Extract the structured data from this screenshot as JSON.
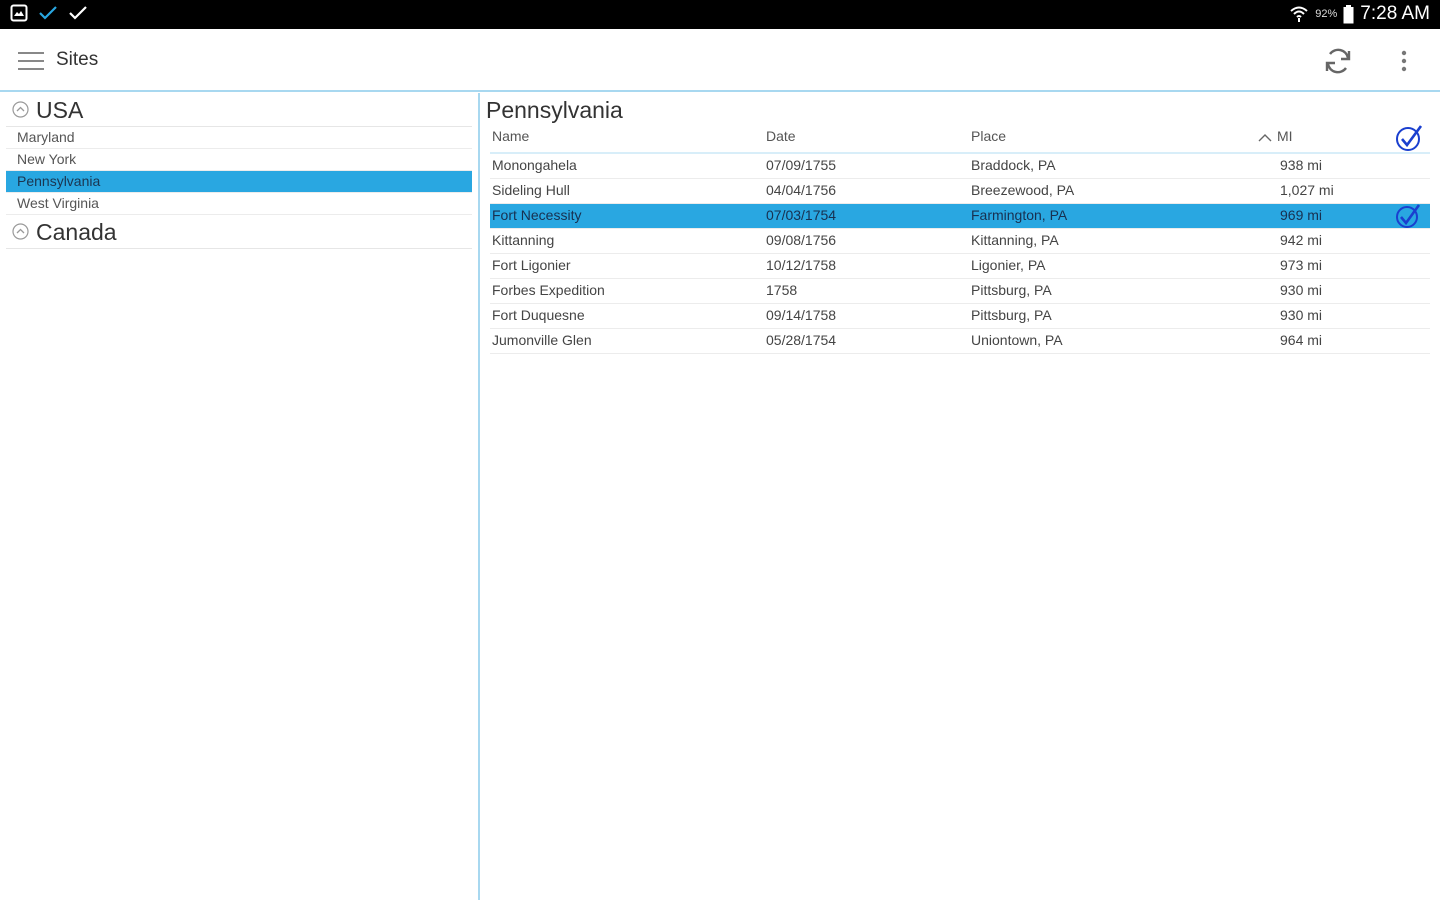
{
  "status_bar": {
    "battery_pct": "92%",
    "time": "7:28 AM"
  },
  "toolbar": {
    "title": "Sites"
  },
  "left_pane": {
    "groups": [
      {
        "label": "USA",
        "expanded": true,
        "items": [
          "Maryland",
          "New York",
          "Pennsylvania",
          "West Virginia"
        ]
      },
      {
        "label": "Canada",
        "expanded": true,
        "items": []
      }
    ],
    "selected_item": "Pennsylvania"
  },
  "right_pane": {
    "title": "Pennsylvania",
    "columns": {
      "name": "Name",
      "date": "Date",
      "place": "Place",
      "mi": "MI"
    },
    "sort": {
      "column": "MI",
      "direction": "ascending"
    },
    "rows": [
      {
        "name": "Monongahela",
        "date": "07/09/1755",
        "place": "Braddock, PA",
        "mi": "938 mi",
        "selected": false
      },
      {
        "name": "Sideling Hull",
        "date": "04/04/1756",
        "place": "Breezewood, PA",
        "mi": "1,027 mi",
        "selected": false
      },
      {
        "name": "Fort Necessity",
        "date": "07/03/1754",
        "place": "Farmington, PA",
        "mi": "969 mi",
        "selected": true
      },
      {
        "name": "Kittanning",
        "date": "09/08/1756",
        "place": "Kittanning, PA",
        "mi": "942 mi",
        "selected": false
      },
      {
        "name": "Fort Ligonier",
        "date": "10/12/1758",
        "place": "Ligonier, PA",
        "mi": "973 mi",
        "selected": false
      },
      {
        "name": "Forbes Expedition",
        "date": "1758",
        "place": "Pittsburg, PA",
        "mi": "930 mi",
        "selected": false
      },
      {
        "name": "Fort Duquesne",
        "date": "09/14/1758",
        "place": "Pittsburg, PA",
        "mi": "930 mi",
        "selected": false
      },
      {
        "name": "Jumonville Glen",
        "date": "05/28/1754",
        "place": "Uniontown, PA",
        "mi": "964 mi",
        "selected": false
      }
    ]
  },
  "colors": {
    "accent": "#29a7e1",
    "divider": "#a8d8f0",
    "check_blue": "#1a3fcf"
  },
  "icons": {
    "status_left": [
      "gallery-icon",
      "check-icon",
      "check-icon"
    ],
    "status_right": [
      "wifi-icon",
      "battery-icon"
    ],
    "toolbar": [
      "menu-icon",
      "refresh-icon",
      "overflow-menu-icon"
    ]
  }
}
